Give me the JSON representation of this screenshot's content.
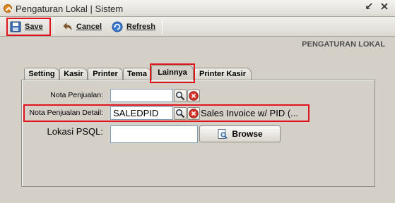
{
  "window": {
    "title": "Pengaturan Lokal | Sistem"
  },
  "toolbar": {
    "save_label": "Save",
    "cancel_label": "Cancel",
    "refresh_label": "Refresh"
  },
  "section_title": "PENGATURAN LOKAL",
  "tabs": [
    {
      "label": "Setting"
    },
    {
      "label": "Kasir"
    },
    {
      "label": "Printer"
    },
    {
      "label": "Tema"
    },
    {
      "label": "Lainnya",
      "active": true
    },
    {
      "label": "Printer Kasir"
    }
  ],
  "form": {
    "nota_penjualan": {
      "label": "Nota Penjualan:",
      "value": ""
    },
    "nota_penjualan_detail": {
      "label": "Nota Penjualan Detail:",
      "value": "SALEDPID",
      "description": "Sales Invoice w/ PID (..."
    },
    "lokasi_psql": {
      "label": "Lokasi PSQL:",
      "value": "",
      "browse_label": "Browse"
    }
  },
  "colors": {
    "highlight": "#e0141c",
    "clear_icon": "#d9342b",
    "background": "#d4d0c8"
  }
}
